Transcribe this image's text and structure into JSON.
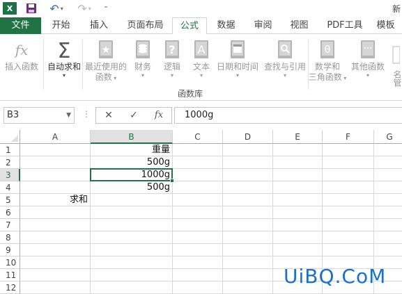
{
  "qat": {
    "logo_text": "X",
    "title_fragment": "新"
  },
  "tabs": [
    {
      "id": "file",
      "label": "文件"
    },
    {
      "id": "home",
      "label": "开始"
    },
    {
      "id": "insert",
      "label": "插入"
    },
    {
      "id": "page-layout",
      "label": "页面布局"
    },
    {
      "id": "formulas",
      "label": "公式",
      "selected": true
    },
    {
      "id": "data",
      "label": "数据"
    },
    {
      "id": "review",
      "label": "审阅"
    },
    {
      "id": "view",
      "label": "视图"
    },
    {
      "id": "pdf-tools",
      "label": "PDF工具"
    },
    {
      "id": "template",
      "label": "模板"
    }
  ],
  "ribbon": {
    "group_label": "函数库",
    "buttons": [
      {
        "id": "insert-function",
        "lines": [
          "插入函数"
        ],
        "icon": "fx-icon",
        "enabled": false,
        "dropdown": false
      },
      {
        "id": "autosum",
        "lines": [
          "自动求和"
        ],
        "icon": "sigma-icon",
        "enabled": true,
        "dropdown": true
      },
      {
        "id": "recently-used",
        "lines": [
          "最近使用的",
          "函数"
        ],
        "icon": "star-book-icon",
        "enabled": false,
        "dropdown": true
      },
      {
        "id": "financial",
        "lines": [
          "财务"
        ],
        "icon": "coins-book-icon",
        "enabled": false,
        "dropdown": true
      },
      {
        "id": "logical",
        "lines": [
          "逻辑"
        ],
        "icon": "question-book-icon",
        "enabled": false,
        "dropdown": true
      },
      {
        "id": "text",
        "lines": [
          "文本"
        ],
        "icon": "letter-a-book-icon",
        "enabled": false,
        "dropdown": true
      },
      {
        "id": "date-time",
        "lines": [
          "日期和时间"
        ],
        "icon": "calendar-book-icon",
        "enabled": false,
        "dropdown": true
      },
      {
        "id": "lookup-reference",
        "lines": [
          "查找与引用"
        ],
        "icon": "magnifier-book-icon",
        "enabled": false,
        "dropdown": true
      },
      {
        "id": "math-trig",
        "lines": [
          "数学和",
          "三角函数"
        ],
        "icon": "theta-book-icon",
        "enabled": false,
        "dropdown": true
      },
      {
        "id": "more-functions",
        "lines": [
          "其他函数"
        ],
        "icon": "dots-book-icon",
        "enabled": false,
        "dropdown": true
      }
    ],
    "collapsed_label": "名管"
  },
  "formula_bar": {
    "name_box": "B3",
    "cancel_symbol": "✕",
    "enter_symbol": "✓",
    "fx_symbol": "fx",
    "content": "1000g"
  },
  "sheet": {
    "columns": [
      "A",
      "B",
      "C",
      "D",
      "E",
      "F",
      "G"
    ],
    "rows": [
      "1",
      "2",
      "3",
      "4",
      "5",
      "6",
      "7",
      "8",
      "9",
      "10",
      "11",
      "12"
    ],
    "active_cell": "B3",
    "cells": [
      {
        "ref": "B1",
        "value": "重量",
        "align": "right"
      },
      {
        "ref": "B2",
        "value": "500g",
        "align": "right"
      },
      {
        "ref": "B3",
        "value": "1000g",
        "align": "right"
      },
      {
        "ref": "B4",
        "value": "500g",
        "align": "right"
      },
      {
        "ref": "A5",
        "value": "求和",
        "align": "right"
      }
    ]
  },
  "watermark": "UiBQ.CoM",
  "colors": {
    "brand_green": "#217346",
    "watermark_blue": "#1a6fd0",
    "header_selected_bg": "#e1e1e1"
  }
}
